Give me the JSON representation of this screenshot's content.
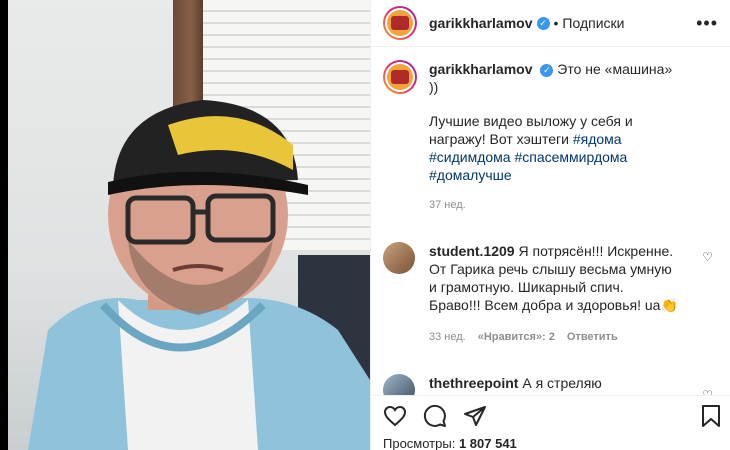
{
  "header": {
    "username": "garikkharlamov",
    "separator": "•",
    "follow_label": "Подписки",
    "more_label": "•••"
  },
  "caption": {
    "username": "garikkharlamov",
    "line1": "Это не «машина»",
    "line2": "))",
    "body": "Лучшие видео выложу у себя и награжу! Вот хэштеги",
    "hashtags": [
      "#ядома",
      "#сидимдома",
      "#спасеммирдома",
      "#домалучше"
    ],
    "time": "37 нед."
  },
  "comments": [
    {
      "username": "student.1209",
      "text": "Я потрясён!!! Искренне. От Гарика речь слышу весьма умную и грамотную. Шикарный спич. Браво!!! Всем добра и здоровья! ua👏",
      "time": "33 нед.",
      "likes": "«Нравится»: 2",
      "reply": "Ответить"
    },
    {
      "username": "thethreepoint",
      "text": "А я стреляю"
    }
  ],
  "actions": {
    "like": "heart-icon",
    "comment": "comment-icon",
    "share": "share-icon",
    "save": "bookmark-icon"
  },
  "views": {
    "label": "Просмотры:",
    "count": "1 807 541"
  },
  "colors": {
    "link": "#00376b",
    "verified": "#3897f0",
    "muted": "#8e8e8e"
  }
}
